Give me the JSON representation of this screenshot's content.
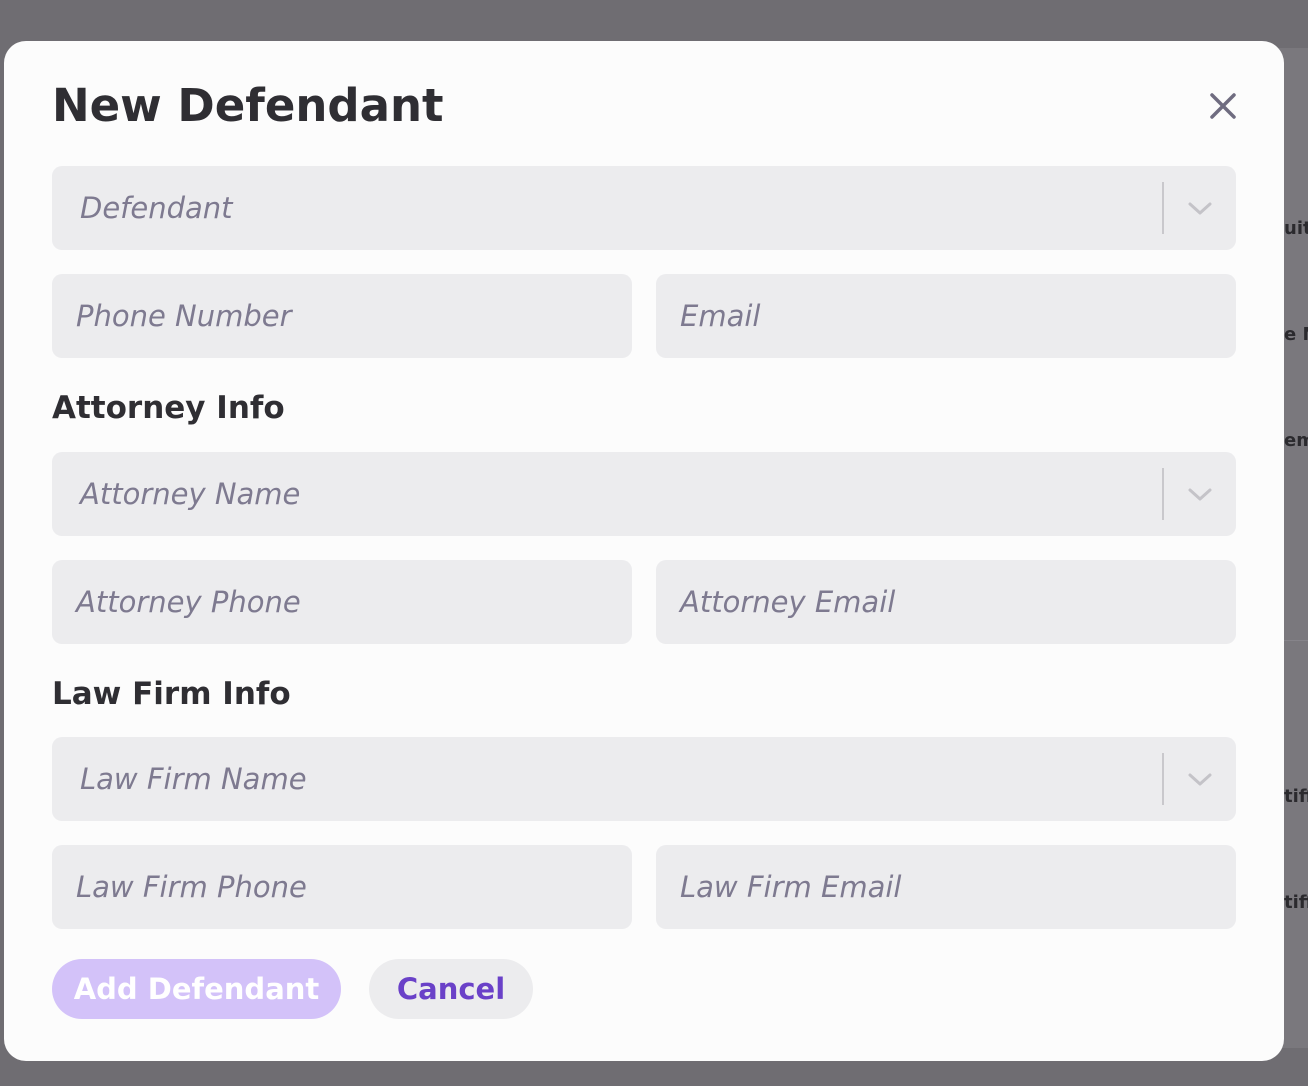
{
  "background": {
    "snippets": [
      "uit",
      "e N",
      "em",
      "tiff",
      "tiff"
    ]
  },
  "modal": {
    "title": "New Defendant",
    "close_icon": "close-icon",
    "defendant": {
      "select_placeholder": "Defendant",
      "phone_placeholder": "Phone Number",
      "email_placeholder": "Email"
    },
    "attorney": {
      "section_title": "Attorney Info",
      "name_placeholder": "Attorney Name",
      "phone_placeholder": "Attorney Phone",
      "email_placeholder": "Attorney Email"
    },
    "law_firm": {
      "section_title": "Law Firm Info",
      "name_placeholder": "Law Firm Name",
      "phone_placeholder": "Law Firm Phone",
      "email_placeholder": "Law Firm Email"
    },
    "actions": {
      "primary_label": "Add Defendant",
      "secondary_label": "Cancel"
    }
  },
  "colors": {
    "accent": "#6a41c8",
    "primary_button_disabled": "#d3c2f9",
    "field_background": "#ececee",
    "placeholder_text": "#7e7a90",
    "overlay": "#6f6d72"
  }
}
